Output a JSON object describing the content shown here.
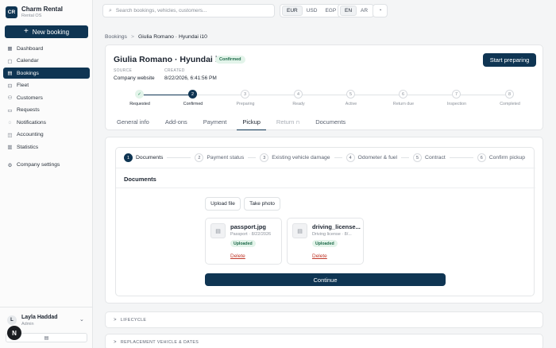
{
  "brand": {
    "logo": "CR",
    "name": "Charm Rental",
    "sub": "Rental OS"
  },
  "sidebar": {
    "new_booking": "New booking",
    "items": [
      {
        "label": "Dashboard",
        "icon": "▦"
      },
      {
        "label": "Calendar",
        "icon": "▢"
      },
      {
        "label": "Bookings",
        "icon": "▤"
      },
      {
        "label": "Fleet",
        "icon": "⊡"
      },
      {
        "label": "Customers",
        "icon": "⚇"
      },
      {
        "label": "Requests",
        "icon": "▭"
      },
      {
        "label": "Notifications",
        "icon": "◌"
      },
      {
        "label": "Accounting",
        "icon": "◫"
      },
      {
        "label": "Statistics",
        "icon": "▥"
      },
      {
        "label": "Company settings",
        "icon": "⚙"
      }
    ]
  },
  "user": {
    "initial": "L",
    "name": "Layla Haddad",
    "role": "Admin",
    "chevron": "⌄",
    "collapse_icon": "▤",
    "dark_badge": "N"
  },
  "topbar": {
    "search_placeholder": "Search bookings, vehicles, customers...",
    "currencies": [
      "EUR",
      "USD",
      "EGP"
    ],
    "languages": [
      "EN",
      "AR"
    ],
    "bell": "♫"
  },
  "breadcrumb": {
    "root": "Bookings",
    "sep": ">",
    "current": "Giulia Romano · Hyundai i10"
  },
  "booking": {
    "title": "Giulia Romano · Hyundai i10",
    "status": "Confirmed",
    "source_label": "SOURCE",
    "source_value": "Company website",
    "created_label": "CREATED",
    "created_value": "8/22/2026, 6:41:56 PM",
    "action": "Start preparing"
  },
  "lifecycle_steps": [
    {
      "mark": "✓",
      "label": "Requested",
      "state": "done"
    },
    {
      "mark": "2",
      "label": "Confirmed",
      "state": "cur"
    },
    {
      "mark": "3",
      "label": "Preparing",
      "state": "todo"
    },
    {
      "mark": "4",
      "label": "Ready",
      "state": "todo"
    },
    {
      "mark": "5",
      "label": "Active",
      "state": "todo"
    },
    {
      "mark": "6",
      "label": "Return due",
      "state": "todo"
    },
    {
      "mark": "7",
      "label": "Inspection",
      "state": "todo"
    },
    {
      "mark": "8",
      "label": "Completed",
      "state": "todo"
    }
  ],
  "tabs": [
    "General info",
    "Add-ons",
    "Payment",
    "Pickup",
    "Return",
    "Documents"
  ],
  "lock_icon": "🔒",
  "pickup_steps": [
    {
      "num": "1",
      "label": "Documents"
    },
    {
      "num": "2",
      "label": "Payment status"
    },
    {
      "num": "3",
      "label": "Existing vehicle damage"
    },
    {
      "num": "4",
      "label": "Odometer & fuel"
    },
    {
      "num": "5",
      "label": "Contract"
    },
    {
      "num": "6",
      "label": "Confirm pickup"
    }
  ],
  "documents": {
    "heading": "Documents",
    "upload": "Upload file",
    "photo": "Take photo",
    "files": [
      {
        "name": "passport.jpg",
        "meta": "Passport · 8/22/2026",
        "badge": "Uploaded",
        "delete": "Delete",
        "icon": "▤"
      },
      {
        "name": "driving_license...",
        "meta": "Driving license · 8/...",
        "badge": "Uploaded",
        "delete": "Delete",
        "icon": "▤"
      }
    ],
    "continue": "Continue"
  },
  "sections": [
    {
      "label": "LIFECYCLE",
      "chevron": ">"
    },
    {
      "label": "REPLACEMENT VEHICLE & DATES",
      "chevron": ">"
    }
  ]
}
